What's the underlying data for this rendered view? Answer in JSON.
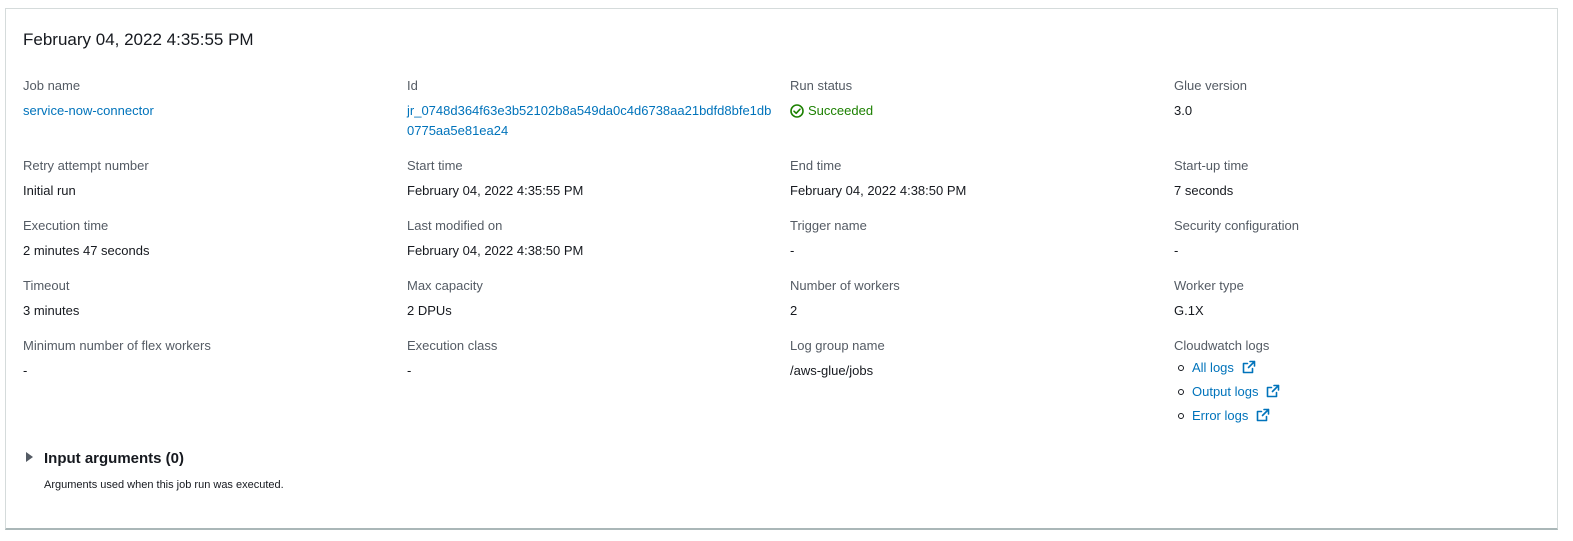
{
  "panel": {
    "title": "February 04, 2022 4:35:55 PM"
  },
  "details": {
    "job_name": {
      "label": "Job name",
      "value": "service-now-connector"
    },
    "id": {
      "label": "Id",
      "value": "jr_0748d364f63e3b52102b8a549da0c4d6738aa21bdfd8bfe1db0775aa5e81ea24"
    },
    "run_status": {
      "label": "Run status",
      "value": "Succeeded"
    },
    "glue_version": {
      "label": "Glue version",
      "value": "3.0"
    },
    "retry_attempt": {
      "label": "Retry attempt number",
      "value": "Initial run"
    },
    "start_time": {
      "label": "Start time",
      "value": "February 04, 2022 4:35:55 PM"
    },
    "end_time": {
      "label": "End time",
      "value": "February 04, 2022 4:38:50 PM"
    },
    "startup_time": {
      "label": "Start-up time",
      "value": "7 seconds"
    },
    "execution_time": {
      "label": "Execution time",
      "value": "2 minutes 47 seconds"
    },
    "last_modified": {
      "label": "Last modified on",
      "value": "February 04, 2022 4:38:50 PM"
    },
    "trigger_name": {
      "label": "Trigger name",
      "value": "-"
    },
    "security_config": {
      "label": "Security configuration",
      "value": "-"
    },
    "timeout": {
      "label": "Timeout",
      "value": "3 minutes"
    },
    "max_capacity": {
      "label": "Max capacity",
      "value": "2 DPUs"
    },
    "num_workers": {
      "label": "Number of workers",
      "value": "2"
    },
    "worker_type": {
      "label": "Worker type",
      "value": "G.1X"
    },
    "min_flex_workers": {
      "label": "Minimum number of flex workers",
      "value": "-"
    },
    "execution_class": {
      "label": "Execution class",
      "value": "-"
    },
    "log_group": {
      "label": "Log group name",
      "value": "/aws-glue/jobs"
    },
    "cloudwatch_logs": {
      "label": "Cloudwatch logs",
      "links": [
        "All logs",
        "Output logs",
        "Error logs"
      ]
    }
  },
  "input_arguments": {
    "title": "Input arguments (0)",
    "description": "Arguments used when this job run was executed."
  },
  "colors": {
    "link": "#0073bb",
    "success": "#1d8102",
    "label": "#545b64",
    "text": "#16191f"
  },
  "icons": {
    "status": "check-circle-icon",
    "external": "external-link-icon",
    "expander": "caret-right-icon"
  }
}
